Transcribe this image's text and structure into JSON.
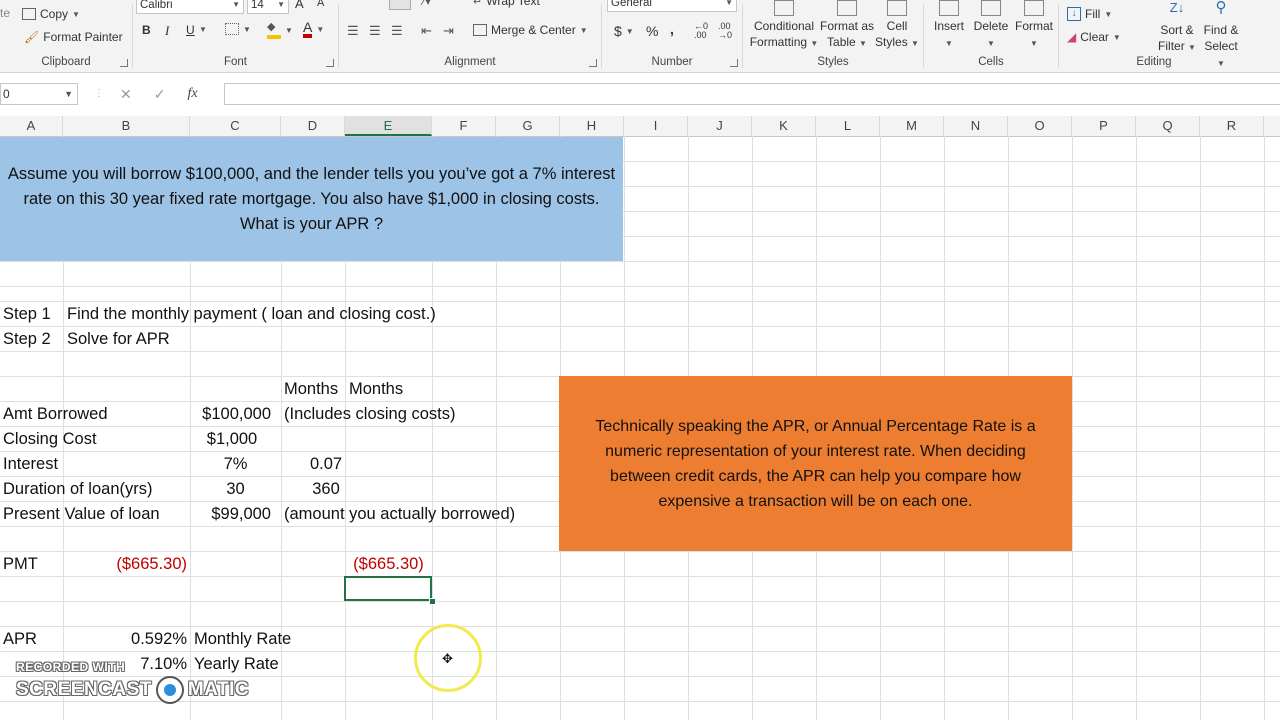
{
  "ribbon": {
    "clipboard": {
      "copy": "Copy",
      "format_painter": "Format Painter",
      "label": "Clipboard"
    },
    "font": {
      "name": "Calibri",
      "size": "14",
      "bold": "B",
      "italic": "I",
      "underline": "U",
      "label": "Font"
    },
    "alignment": {
      "wrap_text": "Wrap Text",
      "merge_center": "Merge & Center",
      "label": "Alignment"
    },
    "number": {
      "format": "General",
      "currency": "$",
      "percent": "%",
      "comma": ",",
      "label": "Number"
    },
    "styles": {
      "conditional": "Conditional",
      "conditional2": "Formatting",
      "format_as": "Format as",
      "format_as2": "Table",
      "cell": "Cell",
      "cell2": "Styles",
      "label": "Styles"
    },
    "cells": {
      "insert": "Insert",
      "delete": "Delete",
      "format": "Format",
      "label": "Cells"
    },
    "editing": {
      "fill": "Fill",
      "clear": "Clear",
      "sort": "Sort &",
      "sort2": "Filter",
      "find": "Find &",
      "find2": "Select",
      "label": "Editing"
    }
  },
  "formula_bar": {
    "name_box": "0",
    "fx": "fx",
    "value": ""
  },
  "columns": [
    "A",
    "B",
    "C",
    "D",
    "E",
    "F",
    "G",
    "H",
    "I",
    "J",
    "K",
    "L",
    "M",
    "N",
    "O",
    "P",
    "Q",
    "R"
  ],
  "selected_column": "E",
  "sheet": {
    "question": "Assume you will borrow $100,000, and the lender tells you you’ve got a 7% interest rate on this 30 year fixed rate mortgage. You also have $1,000 in closing costs. What is your APR ?",
    "step1_label": "Step 1",
    "step1_text": "Find the monthly payment ( loan and closing cost.)",
    "step2_label": "Step 2",
    "step2_text": "Solve for APR",
    "months_header": "Months",
    "months_header2": "Months",
    "amt_borrowed_label": "Amt Borrowed",
    "amt_borrowed_value": "$100,000",
    "amt_borrowed_note": "(Includes closing costs)",
    "closing_cost_label": "Closing Cost",
    "closing_cost_value": "$1,000",
    "interest_label": "Interest",
    "interest_value": "7%",
    "interest_monthly": "0.07",
    "duration_label": "Duration of loan(yrs)",
    "duration_value": "30",
    "duration_months": "360",
    "pv_label": "Present Value of loan",
    "pv_value": "$99,000",
    "pv_note": "(amount you actually borrowed)",
    "pmt_label": "PMT",
    "pmt_value": "($665.30)",
    "pmt_value2": "($665.30)",
    "apr_label": "APR",
    "apr_monthly_value": "0.592%",
    "apr_monthly_label": "Monthly Rate",
    "apr_yearly_value": "7.10%",
    "apr_yearly_label": "Yearly Rate",
    "note": "Technically speaking the APR, or Annual Percentage Rate is a numeric representation of your interest rate. When deciding between credit cards, the APR can help you compare how expensive a transaction will be on each one."
  },
  "watermark": {
    "line1": "RECORDED WITH",
    "line2a": "SCREENCAST",
    "line2b": "MATIC"
  },
  "colors": {
    "question_bg": "#9dc3e6",
    "note_bg": "#ed7d31",
    "negative": "#c00000",
    "selection": "#217346"
  }
}
